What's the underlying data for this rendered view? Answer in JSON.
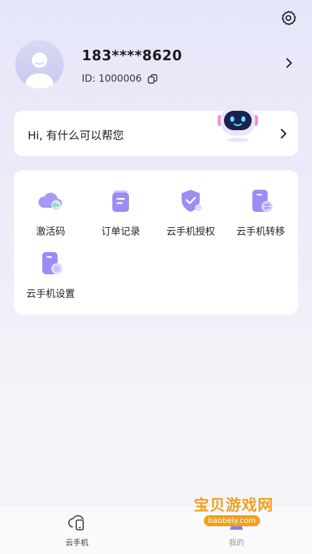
{
  "header": {
    "settings_icon": "gear-icon"
  },
  "profile": {
    "phone": "183****8620",
    "id_text": "ID: 1000006",
    "copy_icon": "copy-icon"
  },
  "ai_card": {
    "greeting": "Hi, 有什么可以帮您"
  },
  "features": [
    {
      "label": "激活码",
      "icon": "cloud-key-icon"
    },
    {
      "label": "订单记录",
      "icon": "order-record-icon"
    },
    {
      "label": "云手机授权",
      "icon": "shield-check-icon"
    },
    {
      "label": "云手机转移",
      "icon": "phone-transfer-icon"
    },
    {
      "label": "云手机设置",
      "icon": "phone-settings-icon"
    }
  ],
  "tabbar": {
    "tabs": [
      {
        "label": "云手机",
        "icon": "cloud-phone-icon"
      },
      {
        "label": "我的",
        "icon": "profile-icon"
      }
    ]
  },
  "watermark": {
    "text": "宝贝游戏网",
    "url": "baobeiy.com"
  },
  "colors": {
    "accent": "#8a7cf0",
    "accent_light": "#b9b0fa",
    "background_top": "#e6e6fa"
  }
}
